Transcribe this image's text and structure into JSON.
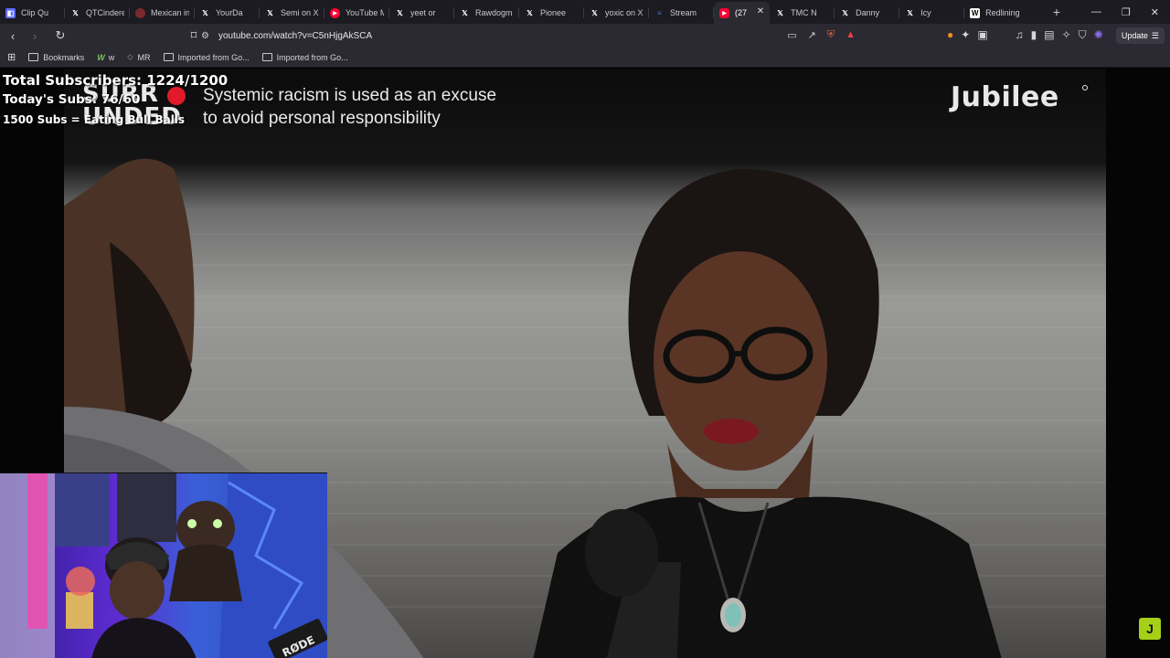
{
  "tabs": [
    {
      "label": "Clip Qu",
      "icon": "clip-icon",
      "color": "#5b6bff"
    },
    {
      "label": "QTCinderel",
      "icon": "x-icon",
      "color": "#000000"
    },
    {
      "label": "Mexican in",
      "icon": "reddit-icon",
      "color": "#7a2a2a"
    },
    {
      "label": "YourDa",
      "icon": "x-icon",
      "color": "#000000"
    },
    {
      "label": "Semi on X",
      "icon": "x-icon",
      "color": "#000000"
    },
    {
      "label": "YouTube M",
      "icon": "youtube-music-icon",
      "color": "#ff0033"
    },
    {
      "label": "yeet or",
      "icon": "x-icon",
      "color": "#000000"
    },
    {
      "label": "Rawdogm",
      "icon": "x-icon",
      "color": "#000000"
    },
    {
      "label": "Pionee",
      "icon": "x-icon",
      "color": "#000000"
    },
    {
      "label": "yoxic on X",
      "icon": "x-icon",
      "color": "#000000"
    },
    {
      "label": "Stream",
      "icon": "stream-icon",
      "color": "#3d7ad6"
    },
    {
      "label": "(27",
      "icon": "youtube-icon",
      "color": "#ff0033",
      "active": true
    },
    {
      "label": "TMC N",
      "icon": "x-icon",
      "color": "#000000"
    },
    {
      "label": "Danny",
      "icon": "x-icon",
      "color": "#000000"
    },
    {
      "label": "Icy",
      "icon": "x-icon",
      "color": "#000000"
    },
    {
      "label": "Redlining",
      "icon": "wikipedia-icon",
      "color": "#ffffff"
    }
  ],
  "address_bar": {
    "url": "youtube.com/watch?v=C5nHjgAkSCA"
  },
  "update_label": "Update",
  "bookmarks": [
    {
      "label": "Bookmarks",
      "icon": "bookmarks-icon"
    },
    {
      "label": "w",
      "icon": "w-icon"
    },
    {
      "label": "MR",
      "icon": "mr-icon"
    },
    {
      "label": "Imported from Go...",
      "icon": "folder-icon"
    },
    {
      "label": "Imported from Go...",
      "icon": "folder-icon"
    }
  ],
  "video": {
    "show_logo": "SURR\nUNDED",
    "caption_line1": "Systemic racism is used as an excuse",
    "caption_line2": "to avoid personal responsibility",
    "brand": "Jubilee",
    "corner_badge": "J"
  },
  "stream_overlay": {
    "total_subscribers": "Total Subscribers: 1224/1200",
    "todays_subs": "Today's Subs: 76/60",
    "goal": "1500 Subs = Eating Bull Balls"
  },
  "colors": {
    "accent_red": "#e0192b",
    "jubilee_badge": "#a6cf17",
    "tab_bg": "#1c1b22",
    "toolbar_bg": "#2b2a33"
  }
}
